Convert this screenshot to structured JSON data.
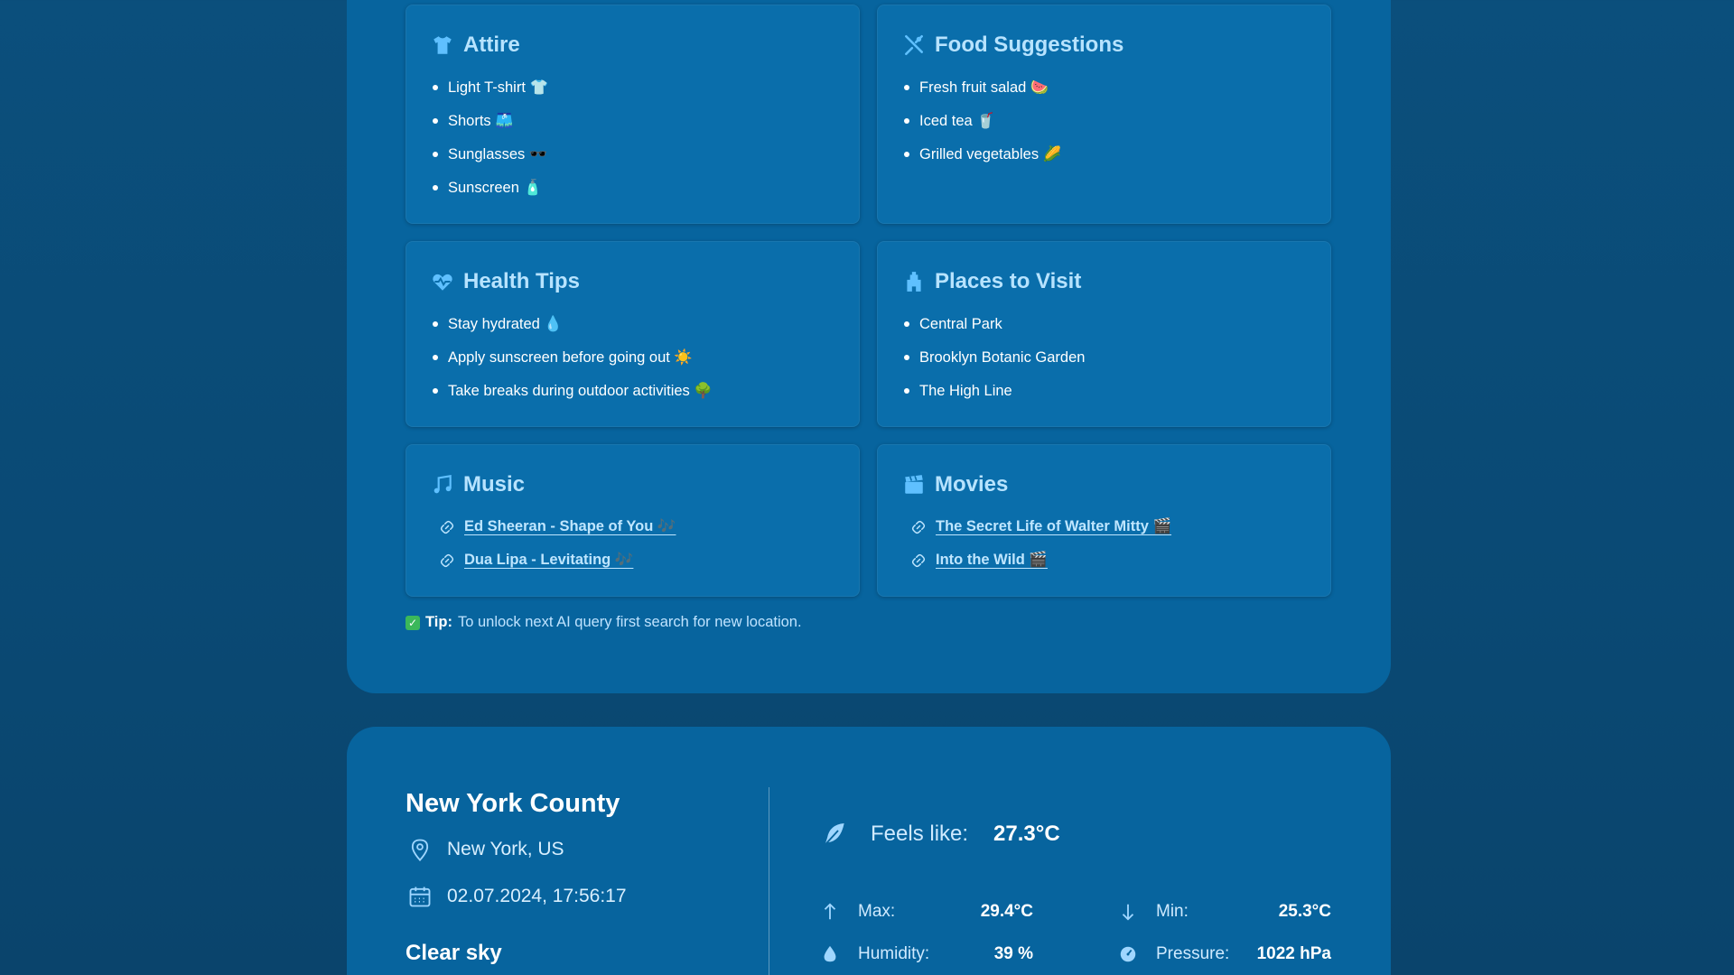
{
  "colors": {
    "background": "#0b4f7c",
    "panel": "#07649e",
    "card": "#0a6eab",
    "title": "#b7e3ff",
    "link": "#bfe6ff",
    "check": "#3bb85a"
  },
  "cards": {
    "attire": {
      "title": "Attire",
      "icon": "tshirt-icon",
      "items": [
        "Light T-shirt 👕",
        "Shorts 🩳",
        "Sunglasses 🕶️",
        "Sunscreen 🧴"
      ]
    },
    "food": {
      "title": "Food Suggestions",
      "icon": "utensils-icon",
      "items": [
        "Fresh fruit salad 🍉",
        "Iced tea 🥤",
        "Grilled vegetables 🌽"
      ]
    },
    "health": {
      "title": "Health Tips",
      "icon": "heart-pulse-icon",
      "items": [
        "Stay hydrated 💧",
        "Apply sunscreen before going out ☀️",
        "Take breaks during outdoor activities 🌳"
      ]
    },
    "places": {
      "title": "Places to Visit",
      "icon": "landmark-icon",
      "items": [
        "Central Park",
        "Brooklyn Botanic Garden",
        "The High Line"
      ]
    },
    "music": {
      "title": "Music",
      "icon": "music-icon",
      "links": [
        "Ed Sheeran - Shape of You 🎶",
        "Dua Lipa - Levitating 🎶"
      ]
    },
    "movies": {
      "title": "Movies",
      "icon": "clapperboard-icon",
      "links": [
        "The Secret Life of Walter Mitty 🎬",
        "Into the Wild 🎬"
      ]
    }
  },
  "tip": {
    "label": "Tip:",
    "text": "To unlock next AI query first search for new location."
  },
  "weather": {
    "city": "New York County",
    "location": "New York, US",
    "datetime": "02.07.2024, 17:56:17",
    "description": "Clear sky",
    "feels_like_label": "Feels like:",
    "feels_like_value": "27.3°C",
    "max_label": "Max:",
    "max_value": "29.4°C",
    "min_label": "Min:",
    "min_value": "25.3°C",
    "humidity_label": "Humidity:",
    "humidity_value": "39 %",
    "pressure_label": "Pressure:",
    "pressure_value": "1022 hPa"
  }
}
